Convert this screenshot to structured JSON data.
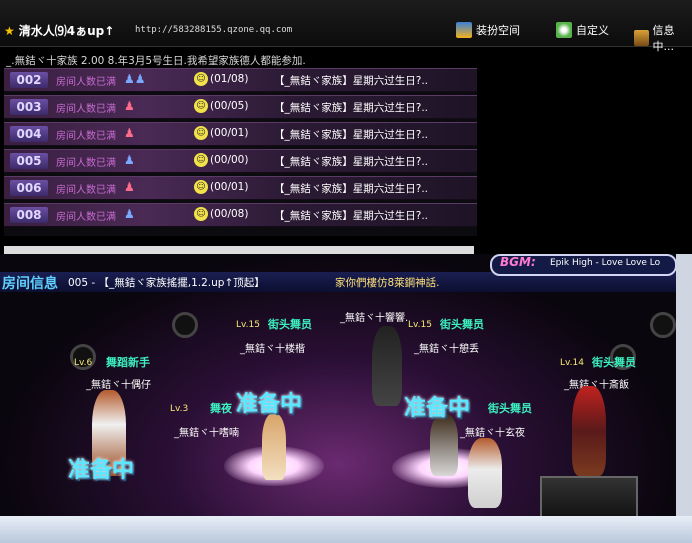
{
  "window": {
    "title": "清水人⑼4ぁup↑",
    "url": "http://583288155.qzone.qq.com",
    "buttons": [
      {
        "label": "装扮空间",
        "icon": "dress-icon"
      },
      {
        "label": "自定义",
        "icon": "customize-icon"
      },
      {
        "label": "信息中...",
        "icon": "info-icon"
      }
    ]
  },
  "notice": "_.無銡ヾ十家族 2.00 8.年3月5号生日.我希望家族德人都能参加.",
  "rooms": [
    {
      "num": "002",
      "status": "房间人数已满",
      "count": "(01/08)",
      "name": "【_無銡ヾ家族】星期六过生日?.."
    },
    {
      "num": "003",
      "status": "房间人数已满",
      "count": "(00/05)",
      "name": "【_無銡ヾ家族】星期六过生日?.."
    },
    {
      "num": "004",
      "status": "房间人数已满",
      "count": "(00/01)",
      "name": "【_無銡ヾ家族】星期六过生日?.."
    },
    {
      "num": "005",
      "status": "房间人数已满",
      "count": "(00/00)",
      "name": "【_無銡ヾ家族】星期六过生日?.."
    },
    {
      "num": "006",
      "status": "房间人数已满",
      "count": "(00/01)",
      "name": "【_無銡ヾ家族】星期六过生日?.."
    },
    {
      "num": "008",
      "status": "房间人数已满",
      "count": "(00/08)",
      "name": "【_無銡ヾ家族】星期六过生日?.."
    }
  ],
  "game": {
    "info_label": "房间信息",
    "info_text": "005 - 【_無銡ヾ家族搖擺,1.2.up↑顶起】",
    "info_text2": "家你們樓仿8萊鋼神話.",
    "bgm_label": "BGM:",
    "bgm_song": "Epik High - Love Love Lo",
    "center_name": "_無銡ヾ十響響.",
    "players": [
      {
        "level": "Lv.6",
        "job": "舞蹈新手",
        "name": "_無銡ヾ十偶仔"
      },
      {
        "level": "Lv.15",
        "job": "街头舞员",
        "name": "_無銡ヾ十楼楷"
      },
      {
        "level": "Lv.3",
        "job": "舞夜",
        "name": "_無銡ヾ十嗜喃"
      },
      {
        "level": "Lv.15",
        "job": "街头舞员",
        "name": "_無銡ヾ十憩丢"
      },
      {
        "level": "",
        "job": "街头舞员",
        "name": "_無銡ヾ十玄夜"
      },
      {
        "level": "Lv.14",
        "job": "街头舞员",
        "name": "_無銡ヾ十斎飯"
      }
    ],
    "ready": "准备中"
  }
}
